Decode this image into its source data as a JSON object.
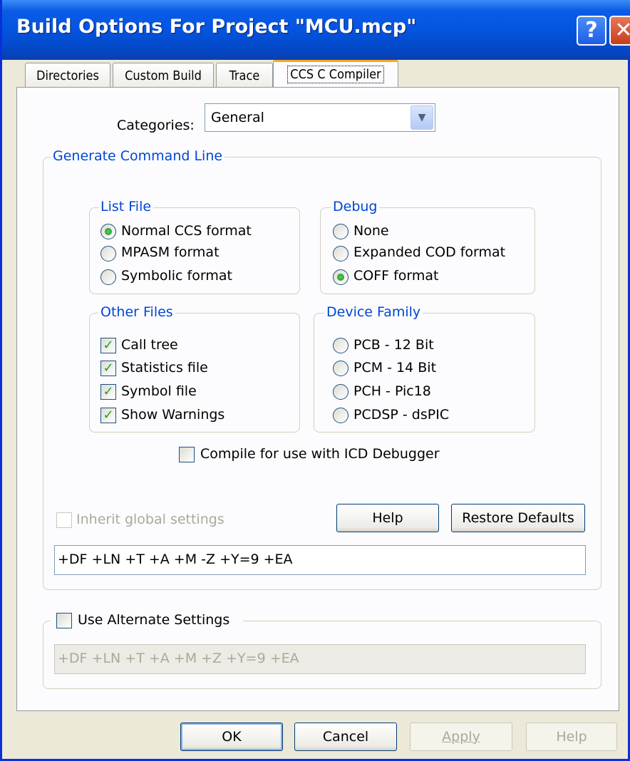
{
  "window": {
    "title": "Build Options For Project \"MCU.mcp\"",
    "help_glyph": "?",
    "close_glyph": "✕"
  },
  "tabs": [
    {
      "label": "Directories"
    },
    {
      "label": "Custom Build"
    },
    {
      "label": "Trace"
    },
    {
      "label": "CCS C Compiler",
      "active": true
    }
  ],
  "categories": {
    "label": "Categories:",
    "value": "General"
  },
  "command_line_group": {
    "title": "Generate Command Line",
    "list_file": {
      "title": "List File",
      "options": [
        "Normal CCS format",
        "MPASM format",
        "Symbolic format"
      ],
      "selected": "Normal CCS format"
    },
    "debug": {
      "title": "Debug",
      "options": [
        "None",
        "Expanded COD format",
        "COFF format"
      ],
      "selected": "COFF format"
    },
    "other_files": {
      "title": "Other Files",
      "items": [
        {
          "label": "Call tree",
          "checked": true
        },
        {
          "label": "Statistics file",
          "checked": true
        },
        {
          "label": "Symbol file",
          "checked": true
        },
        {
          "label": "Show Warnings",
          "checked": true
        }
      ]
    },
    "device_family": {
      "title": "Device Family",
      "options": [
        "PCB - 12 Bit",
        "PCM - 14 Bit",
        "PCH - Pic18",
        "PCDSP - dsPIC"
      ],
      "selected": ""
    },
    "icd_label": "Compile for use with ICD Debugger",
    "icd_checked": false,
    "inherit_label": "Inherit global settings",
    "help_label": "Help",
    "restore_label": "Restore Defaults",
    "command_value": "+DF +LN +T +A +M -Z +Y=9 +EA"
  },
  "alternate_group": {
    "label": "Use Alternate Settings",
    "checked": false,
    "command_value": "+DF +LN +T +A +M +Z +Y=9 +EA"
  },
  "footer": {
    "ok_label": "OK",
    "cancel_label": "Cancel",
    "apply_label": "Apply",
    "help_label": "Help"
  }
}
